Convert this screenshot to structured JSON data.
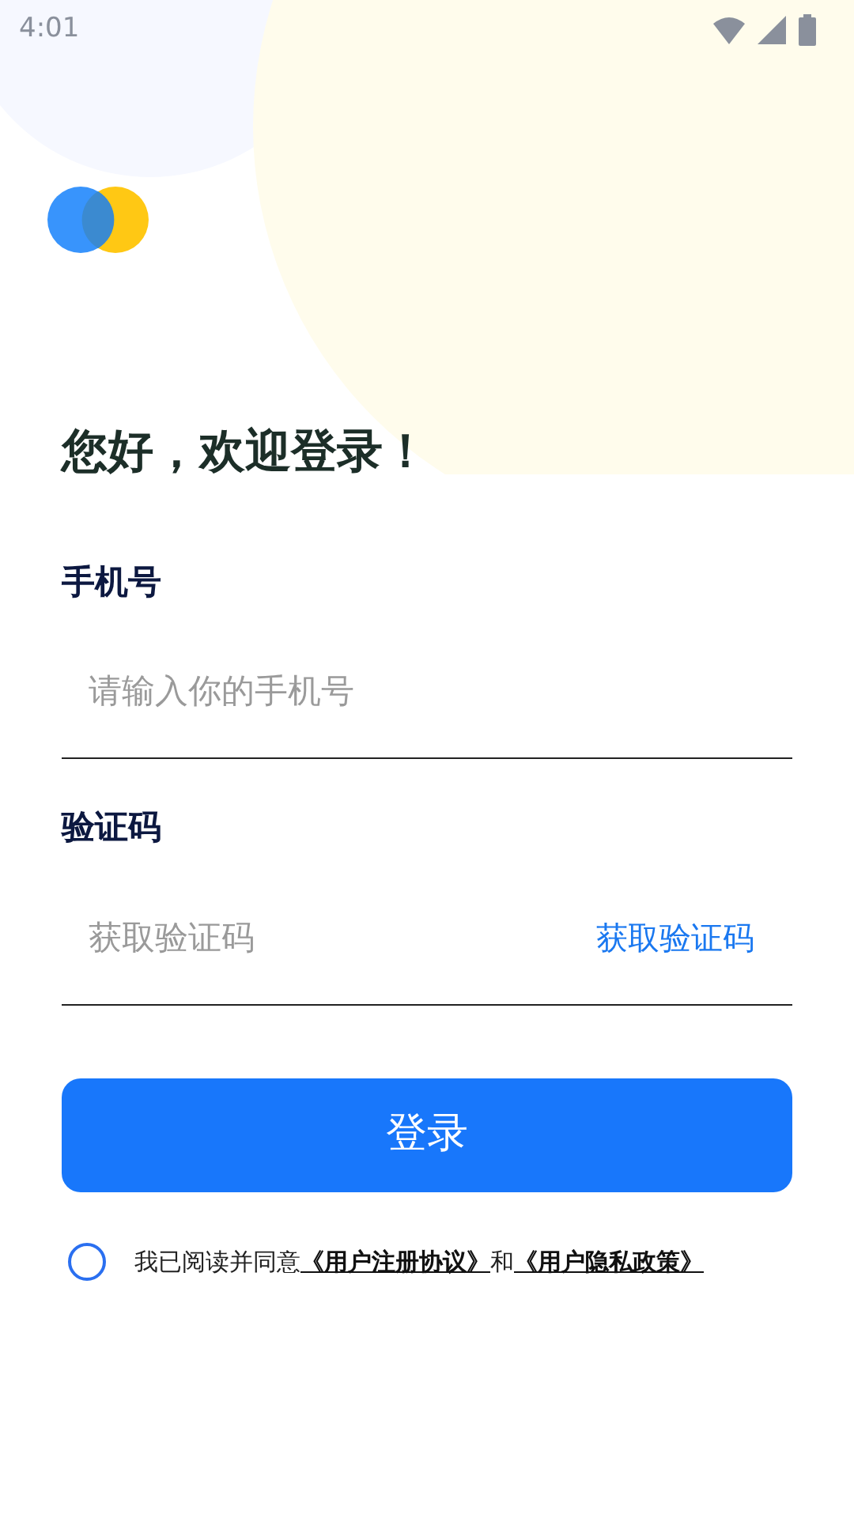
{
  "status_bar": {
    "time": "4:01"
  },
  "greeting": "您好，欢迎登录！",
  "phone": {
    "label": "手机号",
    "placeholder": "请输入你的手机号"
  },
  "code": {
    "label": "验证码",
    "placeholder": "获取验证码",
    "action": "获取验证码"
  },
  "login_button": "登录",
  "agreement": {
    "checked": false,
    "text": "我已阅读并同意",
    "links": [
      "《用户注册协议》",
      "《用户隐私政策》"
    ],
    "joiner": "和"
  }
}
